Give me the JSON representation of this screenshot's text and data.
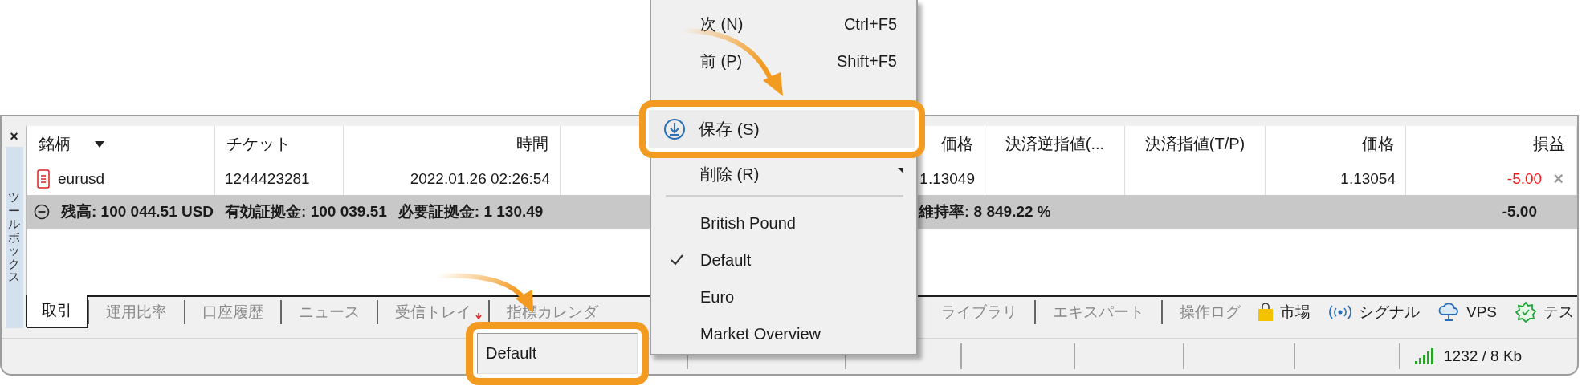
{
  "toolbox": {
    "title": "ツールボックス",
    "close": "×"
  },
  "table": {
    "columns": [
      {
        "label": "銘柄",
        "sorted": true
      },
      {
        "label": "チケット",
        "sorted": false
      },
      {
        "label": "時間",
        "sorted": false
      },
      {
        "label": "価格",
        "sorted": false
      },
      {
        "label": "決済逆指値(...",
        "sorted": false
      },
      {
        "label": "決済指値(T/P)",
        "sorted": false
      },
      {
        "label": "価格",
        "sorted": false
      },
      {
        "label": "損益",
        "sorted": false
      }
    ],
    "rows": [
      {
        "symbol": "eurusd",
        "ticket": "1244423281",
        "time": "2022.01.26 02:26:54",
        "open_price": "1.13049",
        "current_price": "1.13054",
        "profit": "-5.00",
        "loss": true,
        "close": "×"
      }
    ],
    "summary": {
      "items": [
        "残高: 100 044.51 USD",
        "有効証拠金: 100 039.51",
        "必要証拠金: 1 130.49"
      ],
      "margin_level": "維持率: 8 849.22 %",
      "profit": "-5.00"
    }
  },
  "tabs": [
    {
      "label": "取引",
      "selected": true,
      "unread": false
    },
    {
      "label": "運用比率",
      "selected": false,
      "unread": false
    },
    {
      "label": "口座履歴",
      "selected": false,
      "unread": false
    },
    {
      "label": "ニュース",
      "selected": false,
      "unread": false
    },
    {
      "label": "受信トレイ",
      "selected": false,
      "unread": true
    },
    {
      "label": "指標カレンダ",
      "selected": false,
      "unread": false
    }
  ],
  "tabs_after_menu": [
    {
      "label": "ライブラリ",
      "selected": false
    },
    {
      "label": "エキスパート",
      "selected": false
    },
    {
      "label": "操作ログ",
      "selected": false
    }
  ],
  "toolbar": [
    {
      "kind": "market",
      "label": "市場"
    },
    {
      "kind": "signals",
      "label": "シグナル"
    },
    {
      "kind": "vps",
      "label": "VPS"
    },
    {
      "kind": "tester",
      "label": "テス"
    }
  ],
  "status_bar": {
    "traffic": "1232 / 8 Kb"
  },
  "context_menu": {
    "items": [
      {
        "kind": "item",
        "label": "次 (N)",
        "shortcut": "Ctrl+F5",
        "checked": false,
        "submenu": false
      },
      {
        "kind": "item",
        "label": "前 (P)",
        "shortcut": "Shift+F5",
        "checked": false,
        "submenu": false
      },
      {
        "kind": "callout",
        "label": "保存 (S)"
      },
      {
        "kind": "item",
        "label": "削除 (R)",
        "checked": false,
        "submenu": true
      },
      {
        "kind": "separator"
      },
      {
        "kind": "item",
        "label": "British Pound",
        "checked": false,
        "submenu": false
      },
      {
        "kind": "item",
        "label": "Default",
        "checked": true,
        "submenu": false
      },
      {
        "kind": "item",
        "label": "Euro",
        "checked": false,
        "submenu": false
      },
      {
        "kind": "item",
        "label": "Market Overview",
        "checked": false,
        "submenu": false
      }
    ]
  },
  "field_callout": {
    "value": "Default"
  }
}
